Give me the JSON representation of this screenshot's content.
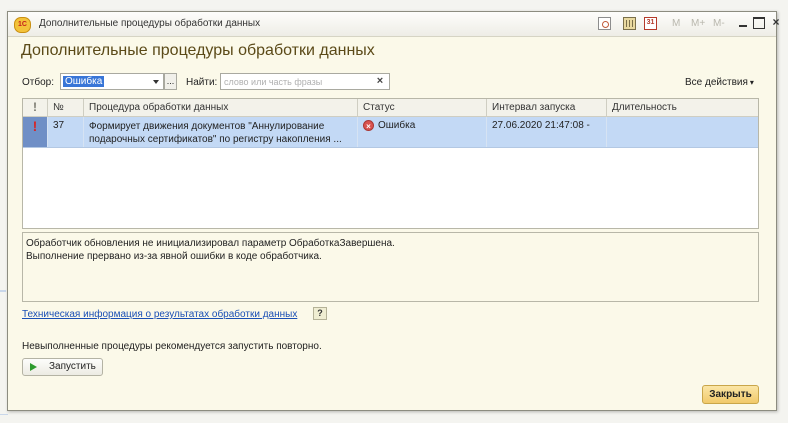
{
  "window": {
    "title": "Дополнительные процедуры обработки данных",
    "logo_text": "1С",
    "toolbar_buttons": [
      "M",
      "M+",
      "M-"
    ],
    "calendar_icon_text": "31"
  },
  "form": {
    "title": "Дополнительные процедуры обработки данных"
  },
  "filter": {
    "label": "Отбор:",
    "value": "Ошибка",
    "more_button": "..."
  },
  "search": {
    "label": "Найти:",
    "placeholder": "слово или часть фразы",
    "value": "",
    "clear_icon": "×"
  },
  "all_actions": {
    "label": "Все действия",
    "caret": "▾"
  },
  "table": {
    "columns": {
      "flag": "!",
      "number": "№",
      "procedure": "Процедура обработки данных",
      "status": "Статус",
      "interval": "Интервал запуска",
      "duration": "Длительность"
    },
    "rows": [
      {
        "flag": "!",
        "number": "37",
        "procedure": "Формирует движения документов \"Аннулирование подарочных сертификатов\" по регистру накопления ...",
        "status": "Ошибка",
        "interval": "27.06.2020 21:47:08 -",
        "duration": ""
      }
    ]
  },
  "error_message": {
    "line1": "Обработчик обновления не инициализировал параметр ОбработкаЗавершена.",
    "line2": "Выполнение прервано из-за явной ошибки в коде обработчика."
  },
  "tech_info_link": "Техническая информация о результатах обработки данных",
  "help_button": "?",
  "hint": "Невыполненные процедуры рекомендуется запустить повторно.",
  "run_button": "Запустить",
  "close_button": "Закрыть",
  "colors": {
    "accent_title": "#5b4a18",
    "selected_row": "#c3d9f5",
    "error_flag": "#d4282a",
    "close_button": "#f1c96a",
    "run_icon": "#2e9b2e"
  }
}
